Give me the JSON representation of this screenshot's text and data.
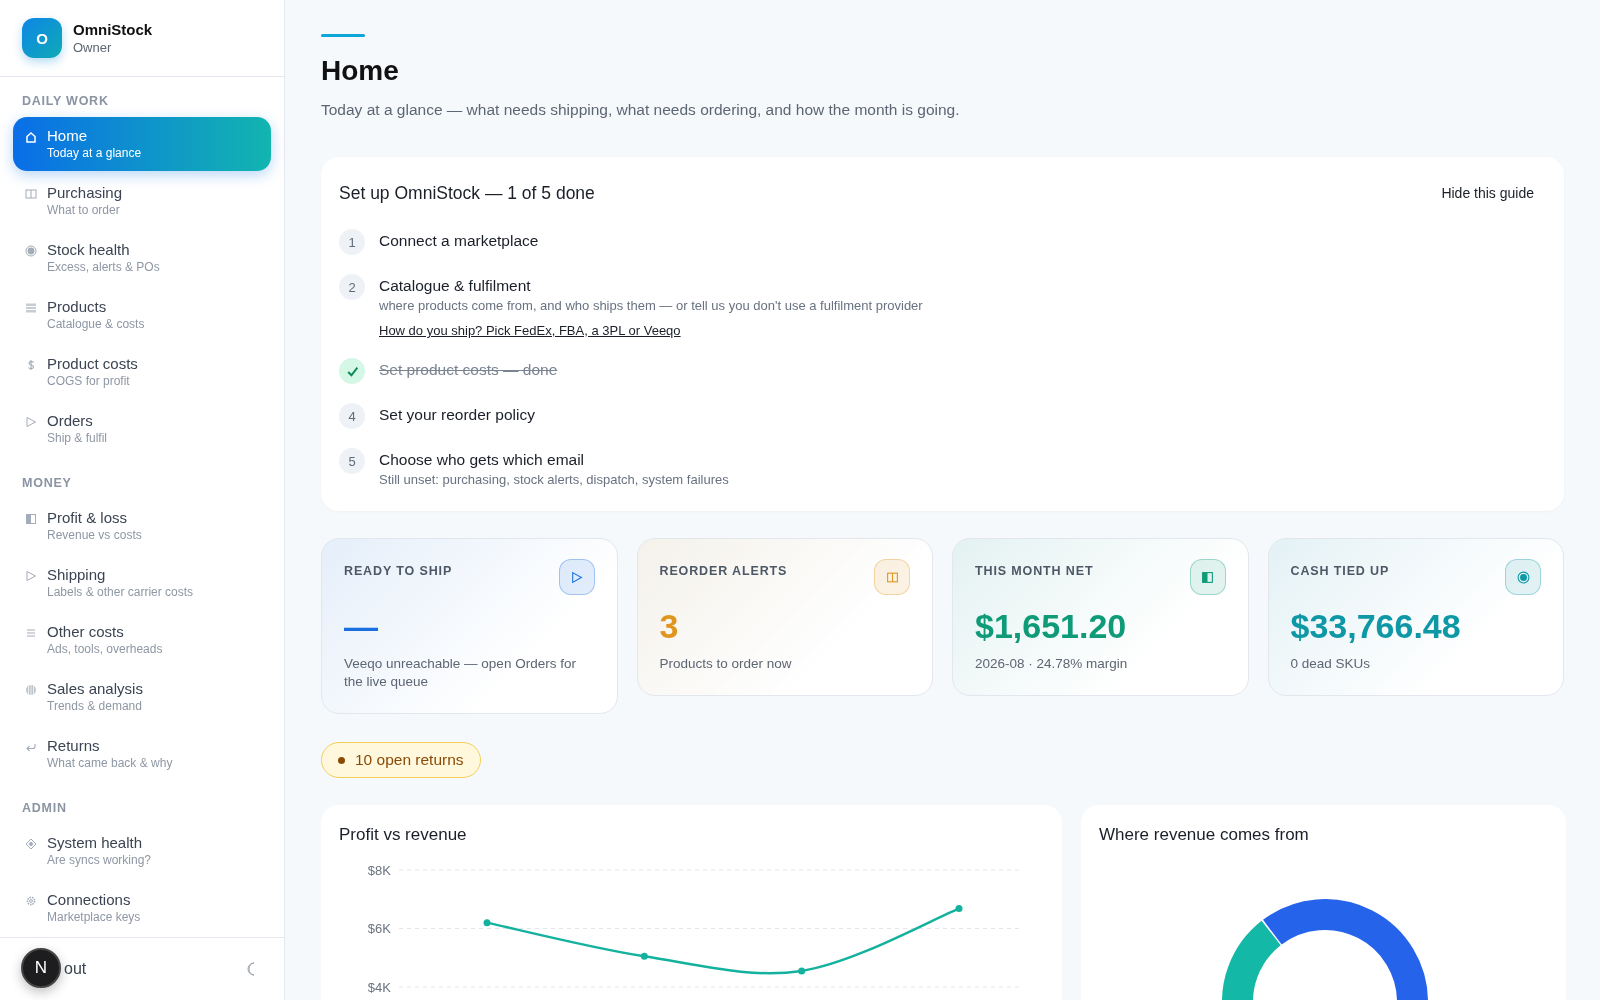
{
  "brand": {
    "logo_letter": "O",
    "name": "OmniStock",
    "role": "Owner"
  },
  "nav_sections": [
    {
      "heading": "DAILY WORK",
      "items": [
        {
          "title": "Home",
          "subtitle": "Today at a glance",
          "selected": true
        },
        {
          "title": "Purchasing",
          "subtitle": "What to order",
          "selected": false
        },
        {
          "title": "Stock health",
          "subtitle": "Excess, alerts & POs",
          "selected": false
        },
        {
          "title": "Products",
          "subtitle": "Catalogue & costs",
          "selected": false
        },
        {
          "title": "Product costs",
          "subtitle": "COGS for profit",
          "selected": false
        },
        {
          "title": "Orders",
          "subtitle": "Ship & fulfil",
          "selected": false
        }
      ]
    },
    {
      "heading": "MONEY",
      "items": [
        {
          "title": "Profit & loss",
          "subtitle": "Revenue vs costs",
          "selected": false
        },
        {
          "title": "Shipping",
          "subtitle": "Labels & other carrier costs",
          "selected": false
        },
        {
          "title": "Other costs",
          "subtitle": "Ads, tools, overheads",
          "selected": false
        },
        {
          "title": "Sales analysis",
          "subtitle": "Trends & demand",
          "selected": false
        },
        {
          "title": "Returns",
          "subtitle": "What came back & why",
          "selected": false
        }
      ]
    },
    {
      "heading": "ADMIN",
      "items": [
        {
          "title": "System health",
          "subtitle": "Are syncs working?",
          "selected": false
        },
        {
          "title": "Connections",
          "subtitle": "Marketplace keys",
          "selected": false
        }
      ]
    }
  ],
  "sidebar_footer": {
    "link_label": "out",
    "dev_badge": "N"
  },
  "page": {
    "title": "Home",
    "subtitle": "Today at a glance — what needs shipping, what needs ordering, and how the month is going."
  },
  "setup_guide": {
    "title": "Set up OmniStock — 1 of 5 done",
    "hide_button": "Hide this guide",
    "steps": [
      {
        "number": "1",
        "title": "Connect a marketplace",
        "done": false
      },
      {
        "number": "2",
        "title": "Catalogue & fulfilment",
        "detail": "where products come from, and who ships them — or tell us you don't use a fulfilment provider",
        "link": "How do you ship? Pick FedEx, FBA, a 3PL or Veeqo",
        "done": false
      },
      {
        "title": "Set product costs — done",
        "done": true
      },
      {
        "number": "4",
        "title": "Set your reorder policy",
        "done": false
      },
      {
        "number": "5",
        "title": "Choose who gets which email",
        "detail": "Still unset: purchasing, stock alerts, dispatch, system failures",
        "done": false
      }
    ]
  },
  "stat_cards": [
    {
      "label": "READY TO SHIP",
      "value": "—",
      "note": "Veeqo unreachable — open Orders for the live queue",
      "color": "#1a6fe0"
    },
    {
      "label": "REORDER ALERTS",
      "value": "3",
      "note": "Products to order now",
      "color": "#e0951e"
    },
    {
      "label": "THIS MONTH NET",
      "value": "$1,651.20",
      "note": "2026-08 · 24.78% margin",
      "color": "#0f9b78"
    },
    {
      "label": "CASH TIED UP",
      "value": "$33,766.48",
      "note": "0 dead SKUs",
      "color": "#0e98a6"
    }
  ],
  "returns_badge": {
    "text": "10 open returns"
  },
  "profit_chart": {
    "title": "Profit vs revenue",
    "chart_data": {
      "type": "line",
      "ylim": [
        4000,
        8000
      ],
      "yticks": [
        {
          "value": 8000,
          "label": "$8K"
        },
        {
          "value": 6000,
          "label": "$6K"
        },
        {
          "value": 4000,
          "label": "$4K"
        }
      ],
      "series": [
        {
          "color": "#14b29e",
          "marker": "circle",
          "values": [
            6200,
            5050,
            4550,
            6680
          ]
        }
      ]
    }
  },
  "revenue_chart": {
    "title": "Where revenue comes from"
  }
}
